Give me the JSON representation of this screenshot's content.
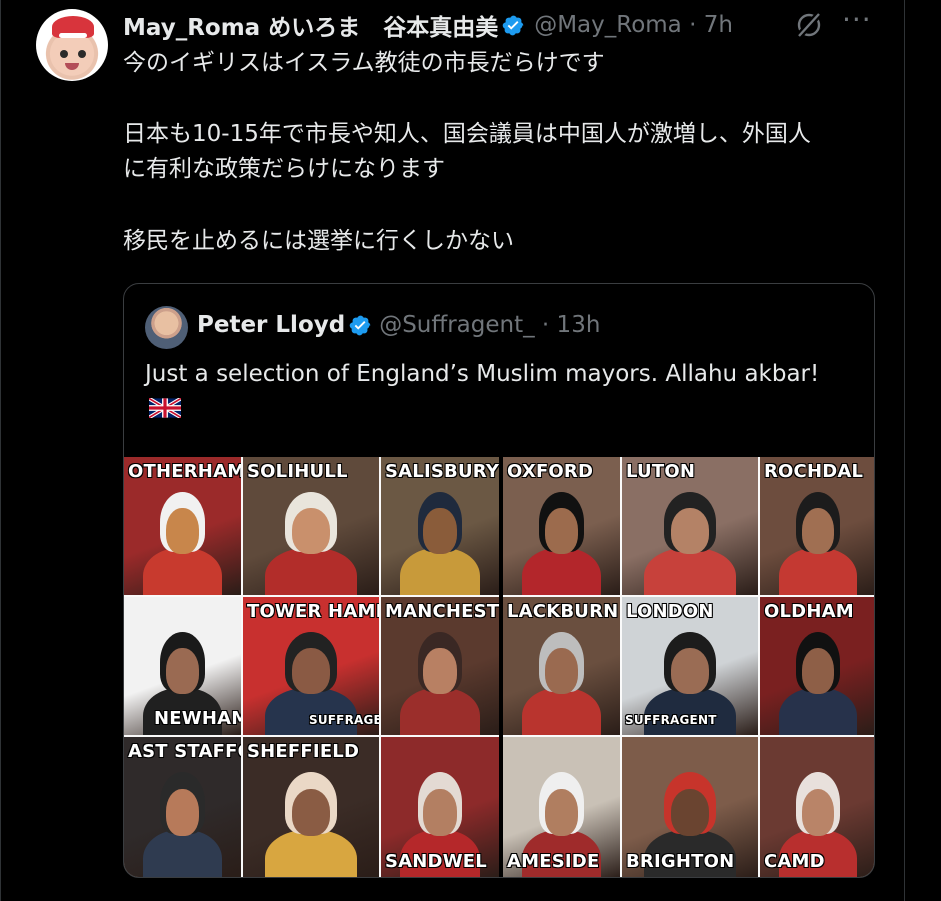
{
  "tweet": {
    "author_name": "May_Roma めいろま　谷本真由美",
    "handle_time": "@May_Roma · 7h",
    "lines": [
      "今のイギリスはイスラム教徒の市長だらけです",
      "日本も10-15年で市長や知人、国会議員は中国人が激増し、外国人",
      "に有利な政策だらけになります",
      "移民を止めるには選挙に行くしかない"
    ]
  },
  "quote": {
    "author_name": "Peter Lloyd",
    "handle_time": "@Suffragent_ · 13h",
    "text": "Just a selection of England’s Muslim mayors. Allahu akbar!"
  },
  "grid": {
    "labels": [
      "OTHERHAM",
      "SOLIHULL",
      "SALISBURY",
      "OXFORD",
      "LUTON",
      "ROCHDAL",
      "NEWHAM",
      "TOWER HAMLETS",
      "MANCHESTER C",
      "LACKBURN",
      "LONDON",
      "OLDHAM",
      "AST STAFFORD",
      "SHEFFIELD",
      "SANDWEL",
      "AMESIDE",
      "BRIGHTON",
      "CAMD"
    ],
    "watermarks": [
      "SUFFRAGENT",
      "SUFFRAGENT"
    ]
  },
  "colors": {
    "background": "#000000",
    "text": "#e7e9ea",
    "secondary": "#71767b",
    "verified": "#1d9bf0",
    "border": "#3a3d40"
  },
  "icons": [
    "verified-badge-icon",
    "grok-icon",
    "more-icon",
    "uk-flag-icon"
  ]
}
